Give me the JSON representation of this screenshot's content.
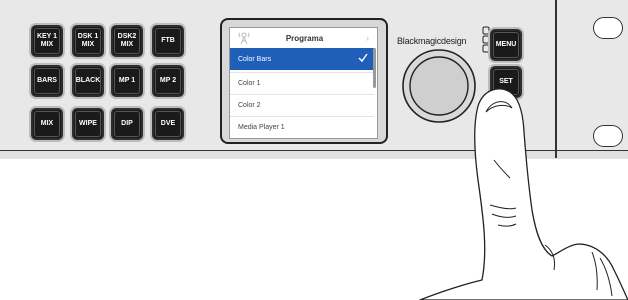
{
  "buttons": {
    "key1_mix": "KEY 1\nMIX",
    "dsk1_mix": "DSK 1\nMIX",
    "dsk2_mix": "DSK2\nMIX",
    "ftb": "FTB",
    "bars": "BARS",
    "black": "BLACK",
    "mp1": "MP 1",
    "mp2": "MP 2",
    "mix": "MIX",
    "wipe": "WIPE",
    "dip": "DIP",
    "dve": "DVE",
    "menu": "MENU",
    "set": "SET"
  },
  "lcd": {
    "title": "Programa",
    "chevron": "›",
    "items": [
      {
        "label": "Color Bars",
        "selected": true
      },
      {
        "label": "Color 1",
        "selected": false
      },
      {
        "label": "Color 2",
        "selected": false
      },
      {
        "label": "Media Player 1",
        "selected": false
      }
    ],
    "accent_color": "#1f5fb8"
  },
  "brand": {
    "logo_text": "Blackmagicdesign"
  },
  "icons": {
    "lcd_header_icon": "antenna-icon",
    "checkmark": "checkmark-icon"
  }
}
